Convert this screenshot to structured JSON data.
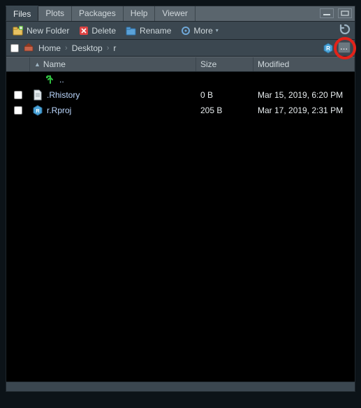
{
  "tabs": {
    "files": "Files",
    "plots": "Plots",
    "packages": "Packages",
    "help": "Help",
    "viewer": "Viewer"
  },
  "toolbar": {
    "new_folder": "New Folder",
    "delete": "Delete",
    "rename": "Rename",
    "more": "More"
  },
  "breadcrumb": {
    "home": "Home",
    "items": [
      "Desktop",
      "r"
    ]
  },
  "columns": {
    "name": "Name",
    "size": "Size",
    "modified": "Modified"
  },
  "rows": {
    "up": "..",
    "r0": {
      "name": ".Rhistory",
      "size": "0 B",
      "modified": "Mar 15, 2019, 6:20 PM"
    },
    "r1": {
      "name": "r.Rproj",
      "size": "205 B",
      "modified": "Mar 17, 2019, 2:31 PM"
    }
  },
  "ellipsis": "..."
}
